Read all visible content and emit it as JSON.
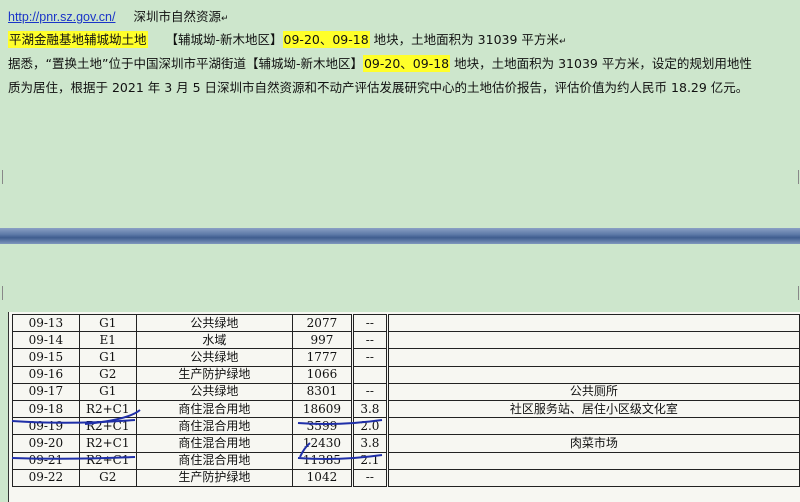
{
  "header": {
    "url": "http://pnr.sz.gov.cn/",
    "source": "深圳市自然资源"
  },
  "line2": {
    "title": "平湖金融基地辅城坳土地",
    "area_label": "【辅城坳-新木地区】",
    "plots": "09-20、09-18",
    "text": "地块，土地面积为",
    "value": "31039",
    "unit": "平方米"
  },
  "para": {
    "a": "据悉，“置换土地”位于中国深圳市平湖街道【辅城坳-新木地区】",
    "plots": "09-20、09-18",
    "b": "地块，土地面积为 31039 平方米，设定的规划用地性",
    "c": "质为居住，根据于  2021  年  3  月  5  日深圳市自然资源和不动产评估发展研究中心的土地估价报告，评估价值为约人民币 18.29 亿元。"
  },
  "table": {
    "rows": [
      [
        "09-13",
        "G1",
        "公共绿地",
        "2077",
        "--",
        ""
      ],
      [
        "09-14",
        "E1",
        "水域",
        "997",
        "--",
        ""
      ],
      [
        "09-15",
        "G1",
        "公共绿地",
        "1777",
        "--",
        ""
      ],
      [
        "09-16",
        "G2",
        "生产防护绿地",
        "1066",
        "",
        ""
      ],
      [
        "09-17",
        "G1",
        "公共绿地",
        "8301",
        "--",
        "公共厕所"
      ],
      [
        "09-18",
        "R2+C1",
        "商住混合用地",
        "18609",
        "3.8",
        "社区服务站、居住小区级文化室"
      ],
      [
        "09-19",
        "R2+C1",
        "商住混合用地",
        "3599",
        "2.0",
        ""
      ],
      [
        "09-20",
        "R2+C1",
        "商住混合用地",
        "12430",
        "3.8",
        "肉菜市场"
      ],
      [
        "09-21",
        "R2+C1",
        "商住混合用地",
        "11385",
        "2.1",
        ""
      ],
      [
        "09-22",
        "G2",
        "生产防护绿地",
        "1042",
        "--",
        ""
      ]
    ]
  },
  "colors": {
    "page_bg": "#cde6cc",
    "highlight": "#ffff2a",
    "link": "#1a35c8",
    "pen": "#1f2fa8",
    "splitter": "#4f6c9c"
  }
}
